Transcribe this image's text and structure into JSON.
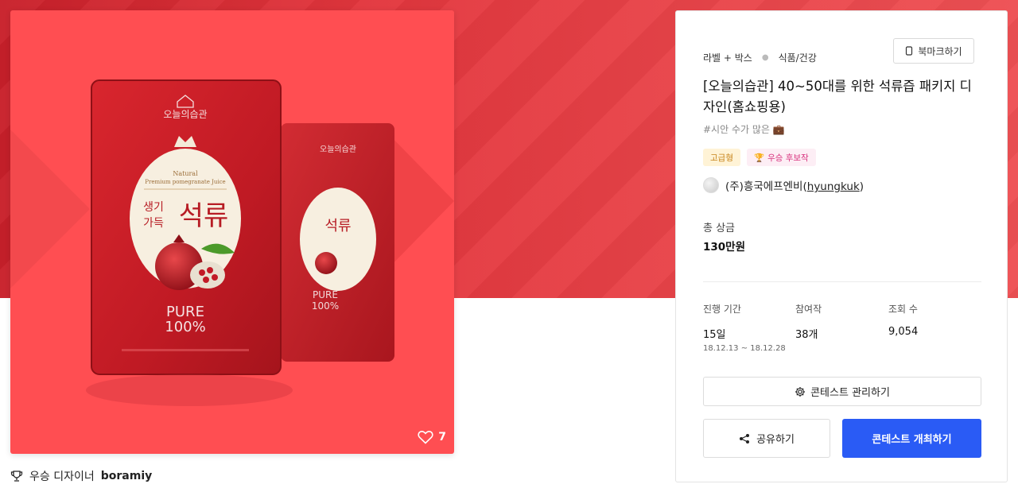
{
  "hero": {
    "likes": "7",
    "pouch_front": {
      "brand": "오늘의습관",
      "natural_line1": "Natural",
      "natural_line2": "Premium pomegranate Juice",
      "side_line1": "생기",
      "side_line2": "가득",
      "main": "석류",
      "pure": "PURE",
      "percent": "100%"
    }
  },
  "winner": {
    "label": "우승 디자이너",
    "name": "boramiy"
  },
  "panel": {
    "category": "라벨 + 박스",
    "subcategory": "식품/건강",
    "bookmark_label": "북마크하기",
    "title": "[오늘의습관] 40~50대를 위한 석류즙 패키지 디자인(홈쇼핑용)",
    "tagline": "#시안 수가 많은 💼",
    "badges": {
      "premium": "고급형",
      "candidate": "우승 후보작"
    },
    "host": {
      "company": "(주)흥국에프엔비",
      "username": "hyungkuk"
    },
    "prize": {
      "label": "총 상금",
      "value": "130만원"
    },
    "stats": {
      "period_label": "진행 기간",
      "period_value": "15일",
      "period_dates": "18.12.13 ~ 18.12.28",
      "entries_label": "참여작",
      "entries_value": "38개",
      "views_label": "조회 수",
      "views_value": "9,054"
    },
    "manage_label": "콘테스트 관리하기",
    "share_label": "공유하기",
    "host_button_label": "콘테스트 개최하기"
  },
  "colors": {
    "accent": "#2a5bf5",
    "hero_red": "#e2363d",
    "image_bg": "#ff4e52"
  }
}
